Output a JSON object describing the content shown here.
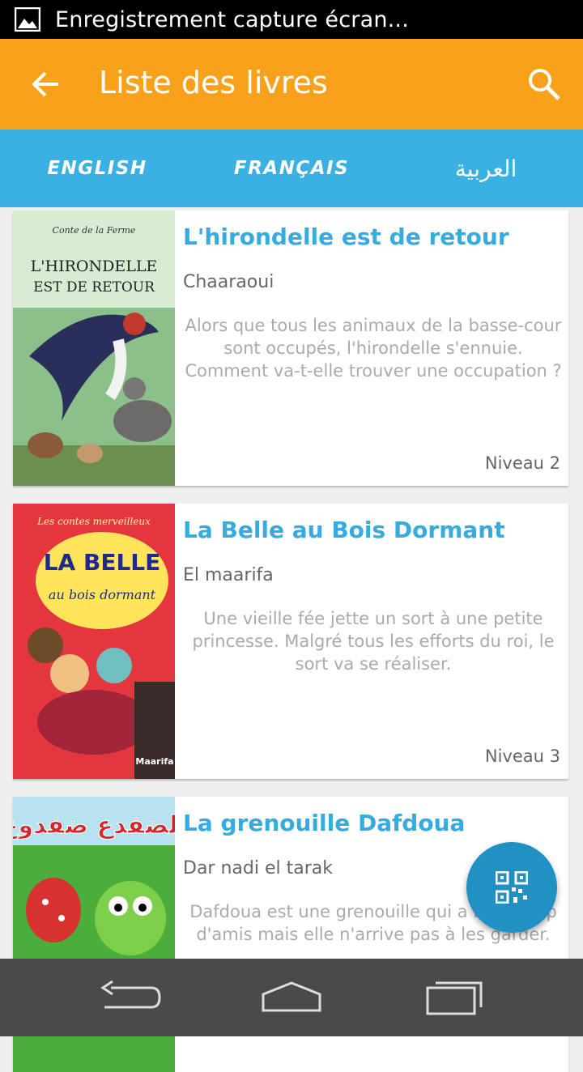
{
  "status_bar": {
    "icon": "image-icon",
    "text": "Enregistrement capture écran..."
  },
  "app_bar": {
    "back_icon": "arrow-left-icon",
    "title": "Liste des livres",
    "search_icon": "search-icon"
  },
  "tabs": [
    {
      "label": "ENGLISH"
    },
    {
      "label": "FRANÇAIS"
    },
    {
      "label": "العربية"
    }
  ],
  "books": [
    {
      "title": "L'hirondelle est de retour",
      "author": "Chaaraoui",
      "description": "Alors que tous les animaux de la basse-cour sont occupés, l'hirondelle s'ennuie. Comment va-t-elle trouver une occupation ?",
      "level": "Niveau 2",
      "cover": {
        "top": "Conte de la Ferme",
        "title1": "L'HIRONDELLE",
        "title2": "EST DE RETOUR",
        "bg": "#6fa06a"
      }
    },
    {
      "title": "La Belle au Bois Dormant",
      "author": "El maarifa",
      "description": "Une vieille fée jette un sort à une petite princesse. Malgré tous les efforts du roi, le sort va se réaliser.",
      "level": "Niveau 3",
      "cover": {
        "top": "Les contes merveilleux",
        "title1": "LA BELLE",
        "title2": "au bois dormant",
        "brand": "Maarifa",
        "bg": "#e4363e"
      }
    },
    {
      "title": "La grenouille Dafdoua",
      "author": "Dar nadi el tarak",
      "description": "Dafdoua est une grenouille qui a beaucoup d'amis mais elle n'arrive pas à les garder.",
      "level": "",
      "cover": {
        "title1": "الضفدع ضفدوع",
        "bg": "#4cae3a"
      }
    }
  ],
  "fab": {
    "icon": "qr-code-icon"
  },
  "nav_bar": {
    "back_icon": "back-icon",
    "home_icon": "home-icon",
    "recents_icon": "recents-icon"
  },
  "colors": {
    "app_bar": "#f9a11b",
    "tabs": "#3bb0e3",
    "title": "#35abe0",
    "fab": "#2191c4"
  }
}
